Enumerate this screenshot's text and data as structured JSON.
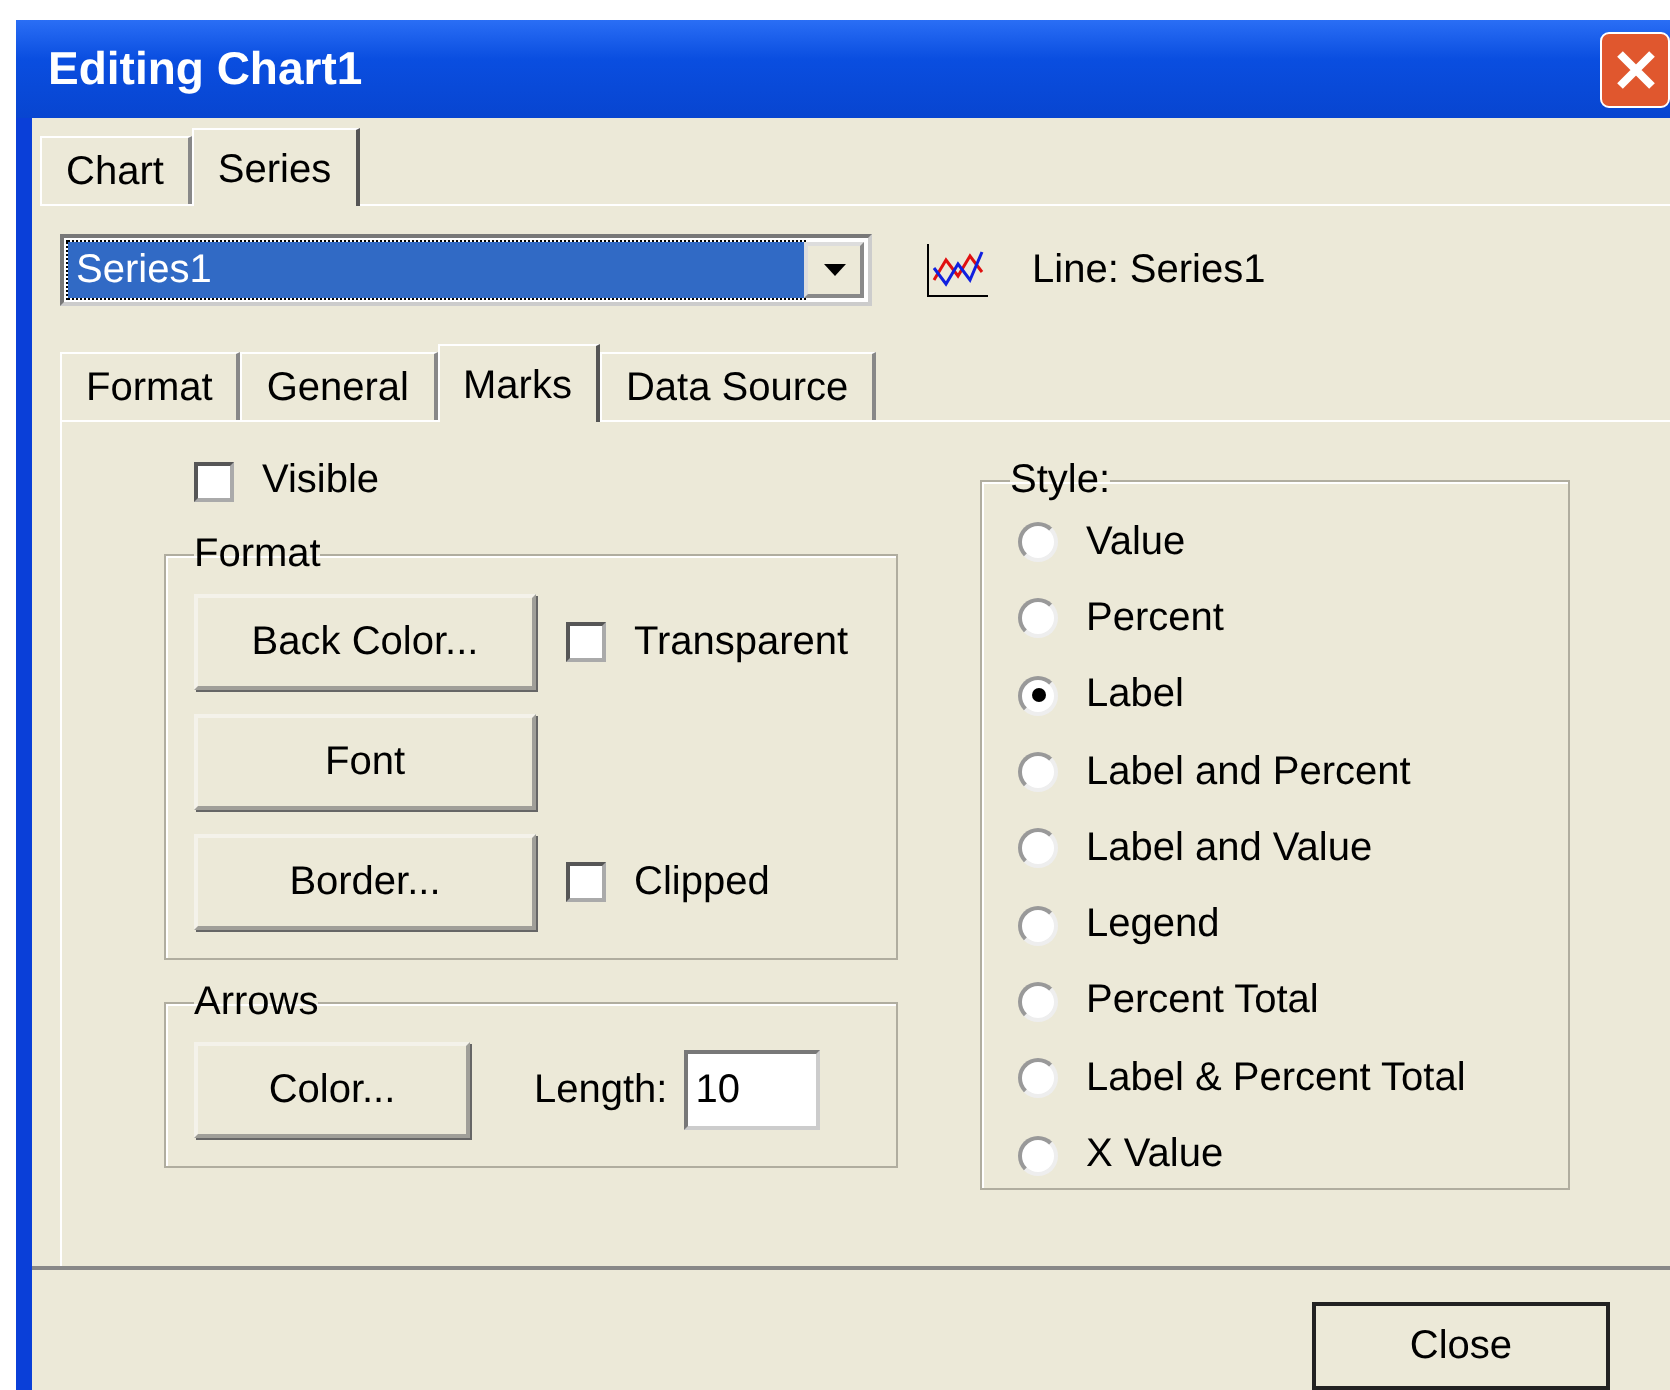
{
  "window": {
    "title": "Editing Chart1"
  },
  "tabs": [
    {
      "label": "Chart",
      "selected": false
    },
    {
      "label": "Series",
      "selected": true
    }
  ],
  "series_select": {
    "value": "Series1"
  },
  "series_info": "Line: Series1",
  "sub_tabs": [
    {
      "label": "Format",
      "selected": false
    },
    {
      "label": "General",
      "selected": false
    },
    {
      "label": "Marks",
      "selected": true
    },
    {
      "label": "Data Source",
      "selected": false
    }
  ],
  "visible": {
    "label": "Visible",
    "checked": false
  },
  "format_group": {
    "title": "Format",
    "rows": [
      {
        "button": "Back Color...",
        "checkbox": {
          "label": "Transparent",
          "checked": false
        }
      },
      {
        "button": "Font"
      },
      {
        "button": "Border...",
        "checkbox": {
          "label": "Clipped",
          "checked": false
        }
      }
    ]
  },
  "arrows_group": {
    "title": "Arrows",
    "button": "Color...",
    "length_label": "Length:",
    "length_value": "10"
  },
  "style_group": {
    "title": "Style:",
    "options": [
      {
        "label": "Value",
        "selected": false
      },
      {
        "label": "Percent",
        "selected": false
      },
      {
        "label": "Label",
        "selected": true
      },
      {
        "label": "Label and Percent",
        "selected": false
      },
      {
        "label": "Label and Value",
        "selected": false
      },
      {
        "label": "Legend",
        "selected": false
      },
      {
        "label": "Percent Total",
        "selected": false
      },
      {
        "label": "Label & Percent Total",
        "selected": false
      },
      {
        "label": "X Value",
        "selected": false
      }
    ]
  },
  "buttons": [
    "Close"
  ]
}
